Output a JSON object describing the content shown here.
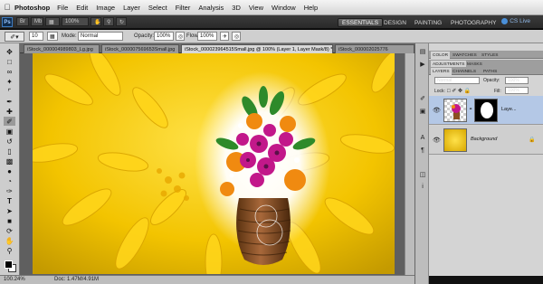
{
  "menubar": {
    "app": "Photoshop",
    "items": [
      "File",
      "Edit",
      "Image",
      "Layer",
      "Select",
      "Filter",
      "Analysis",
      "3D",
      "View",
      "Window",
      "Help"
    ]
  },
  "appbar": {
    "logo": "Ps",
    "zoom": "100%",
    "workspaces": [
      "ESSENTIALS",
      "DESIGN",
      "PAINTING",
      "PHOTOGRAPHY"
    ],
    "cs_live": "CS Live"
  },
  "options": {
    "brush_size": "10",
    "mode_label": "Mode:",
    "mode_value": "Normal",
    "opacity_label": "Opacity:",
    "opacity_value": "100%",
    "flow_label": "Flow:",
    "flow_value": "100%"
  },
  "tabs": [
    {
      "label": "iStock_000004989803_Lg.jpg"
    },
    {
      "label": "iStock_000007569653Small.jpg"
    },
    {
      "label": "iStock_000023964515Small.jpg @ 100% (Layer 1, Layer Mask/8) *"
    },
    {
      "label": "iStock_000002025776"
    }
  ],
  "status": {
    "zoom": "100.24%",
    "doc": "Doc: 1.47M/4.91M"
  },
  "panels": {
    "top_tabs": [
      "COLOR",
      "SWATCHES",
      "STYLES"
    ],
    "mid_tabs": [
      "ADJUSTMENTS",
      "MASKS"
    ],
    "layer_tabs": [
      "LAYERS",
      "CHANNELS",
      "PATHS"
    ],
    "blend_mode": "Normal",
    "opacity_label": "Opacity:",
    "opacity_value": "100%",
    "lock_label": "Lock:",
    "fill_label": "Fill:",
    "fill_value": "100%",
    "layers": [
      {
        "name": "Laye..."
      },
      {
        "name": "Background"
      }
    ]
  },
  "icons": {
    "apple": "apple-icon",
    "brush": "brush-icon",
    "eye": "eye-icon",
    "lock": "lock-icon"
  }
}
